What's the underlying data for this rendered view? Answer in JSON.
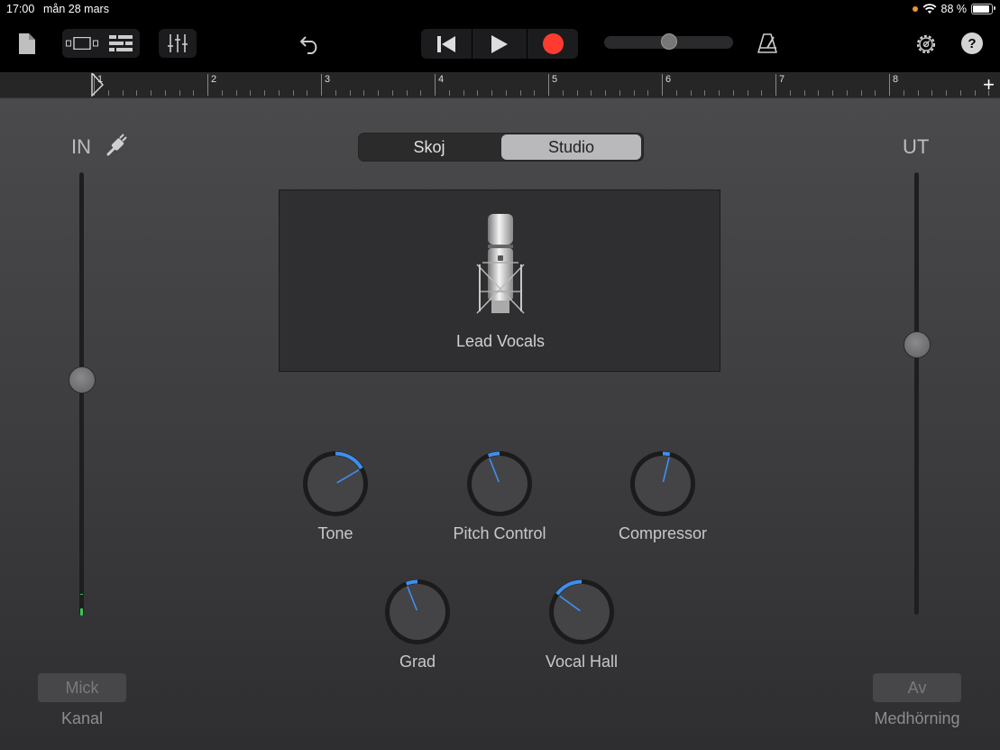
{
  "status_bar": {
    "time": "17:00",
    "date": "mån 28 mars",
    "battery": "88 %",
    "battery_level": 0.88
  },
  "toolbar": {
    "icons": [
      "document-icon",
      "track-view-icon",
      "tracks-list-icon",
      "mixer-icon",
      "undo-icon",
      "rewind-icon",
      "play-icon",
      "record-icon",
      "metronome-icon",
      "settings-icon",
      "help-icon"
    ],
    "master_volume": 0.5
  },
  "ruler": {
    "bars": [
      "1",
      "2",
      "3",
      "4",
      "5",
      "6",
      "7",
      "8"
    ],
    "add_label": "+"
  },
  "input": {
    "label": "IN",
    "fader_level": 0.53,
    "button": "Mick",
    "button_caption": "Kanal"
  },
  "output": {
    "label": "UT",
    "fader_level": 0.61,
    "button": "Av",
    "button_caption": "Medhörning"
  },
  "mode_tabs": [
    {
      "label": "Skoj",
      "selected": false
    },
    {
      "label": "Studio",
      "selected": true
    }
  ],
  "preset": {
    "name": "Lead Vocals",
    "icon": "microphone-icon"
  },
  "knobs": [
    {
      "label": "Tone",
      "value": 0.72
    },
    {
      "label": "Pitch Control",
      "value": 0.42
    },
    {
      "label": "Compressor",
      "value": 0.55
    },
    {
      "label": "Grad",
      "value": 0.42
    },
    {
      "label": "Vocal Hall",
      "value": 0.3
    }
  ],
  "colors": {
    "accent": "#3f8ff0",
    "record": "#ff3b30",
    "level_meter": "#34c759"
  }
}
